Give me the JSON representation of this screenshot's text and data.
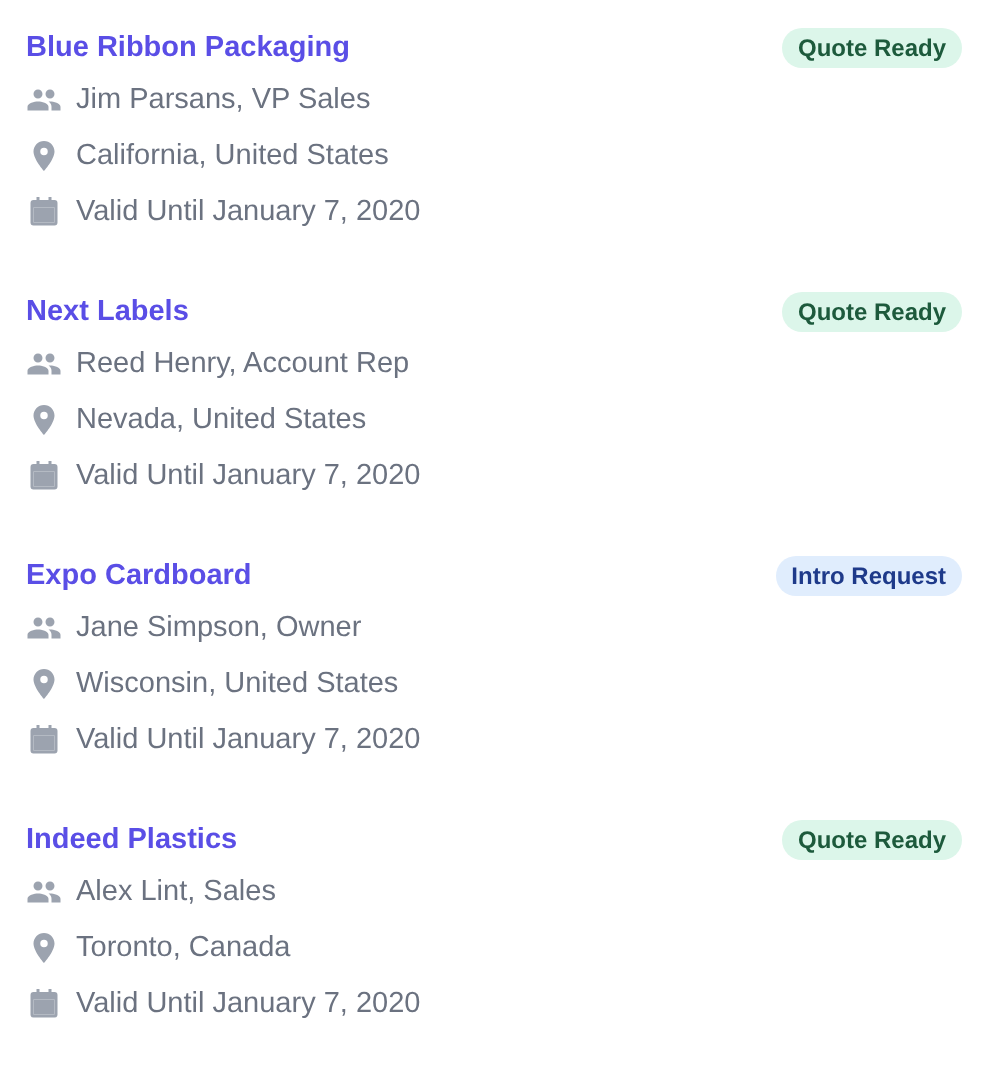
{
  "leads": [
    {
      "company": "Blue Ribbon Packaging",
      "badge": {
        "label": "Quote Ready",
        "kind": "success"
      },
      "details": [
        {
          "kind": "contact",
          "text": "Jim Parsans, VP Sales"
        },
        {
          "kind": "location",
          "text": "California, United States"
        },
        {
          "kind": "date",
          "text": "Valid Until January 7, 2020"
        }
      ]
    },
    {
      "company": "Next Labels",
      "badge": {
        "label": "Quote Ready",
        "kind": "success"
      },
      "details": [
        {
          "kind": "contact",
          "text": "Reed Henry, Account Rep"
        },
        {
          "kind": "location",
          "text": "Nevada, United States"
        },
        {
          "kind": "date",
          "text": "Valid Until January 7, 2020"
        }
      ]
    },
    {
      "company": "Expo Cardboard",
      "badge": {
        "label": "Intro Request",
        "kind": "info"
      },
      "details": [
        {
          "kind": "contact",
          "text": "Jane Simpson, Owner"
        },
        {
          "kind": "location",
          "text": "Wisconsin, United States"
        },
        {
          "kind": "date",
          "text": "Valid Until January 7, 2020"
        }
      ]
    },
    {
      "company": "Indeed Plastics",
      "badge": {
        "label": "Quote Ready",
        "kind": "success"
      },
      "details": [
        {
          "kind": "contact",
          "text": "Alex Lint, Sales"
        },
        {
          "kind": "location",
          "text": "Toronto, Canada"
        },
        {
          "kind": "date",
          "text": "Valid Until January 7, 2020"
        }
      ]
    }
  ]
}
